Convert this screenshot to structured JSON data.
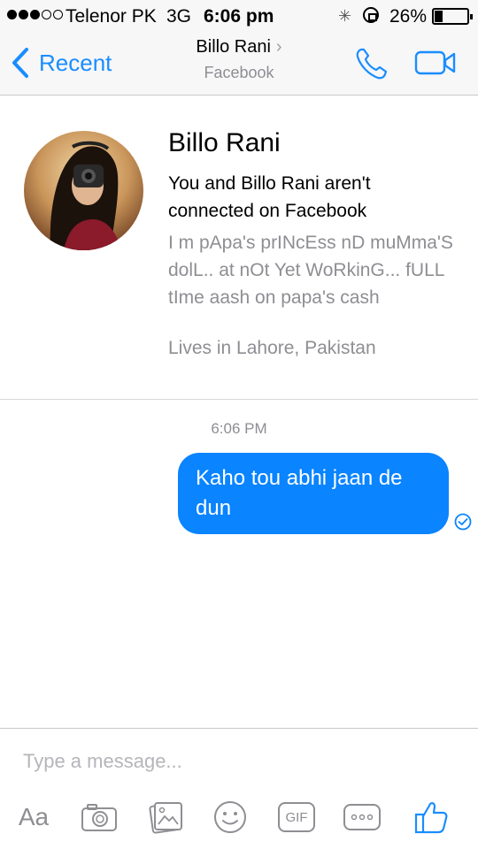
{
  "status_bar": {
    "carrier": "Telenor PK",
    "network": "3G",
    "time": "6:06 pm",
    "battery": "26%",
    "battery_level": 0.26,
    "signal_strength": 3,
    "signal_max": 5
  },
  "nav": {
    "back_label": "Recent",
    "title": "Billo Rani",
    "title_chevron": "›",
    "subtitle": "Facebook",
    "accent_color": "#1a8dff",
    "icons": [
      "chevron-left-icon",
      "phone-icon",
      "video-camera-icon"
    ]
  },
  "profile": {
    "name": "Billo Rani",
    "connection_text": "You and Billo Rani aren't connected on Facebook",
    "bio": "I m pApa's prINcEss nD muMma'S dolL.. at nOt Yet WoRkinG... fULL tIme aash on papa's cash",
    "location": "Lives in Lahore, Pakistan"
  },
  "conversation": {
    "timestamp": "6:06 PM",
    "messages": [
      {
        "text": "Kaho tou abhi jaan de dun",
        "sender": "me",
        "status": "sent"
      }
    ],
    "bubble_color": "#0a84ff"
  },
  "composer": {
    "placeholder": "Type a message...",
    "value": "",
    "aa_label": "Aa",
    "gif_label": "GIF",
    "icons": [
      "text-size-icon",
      "camera-icon",
      "photo-gallery-icon",
      "emoji-icon",
      "gif-icon",
      "more-icon",
      "thumbs-up-icon"
    ]
  }
}
